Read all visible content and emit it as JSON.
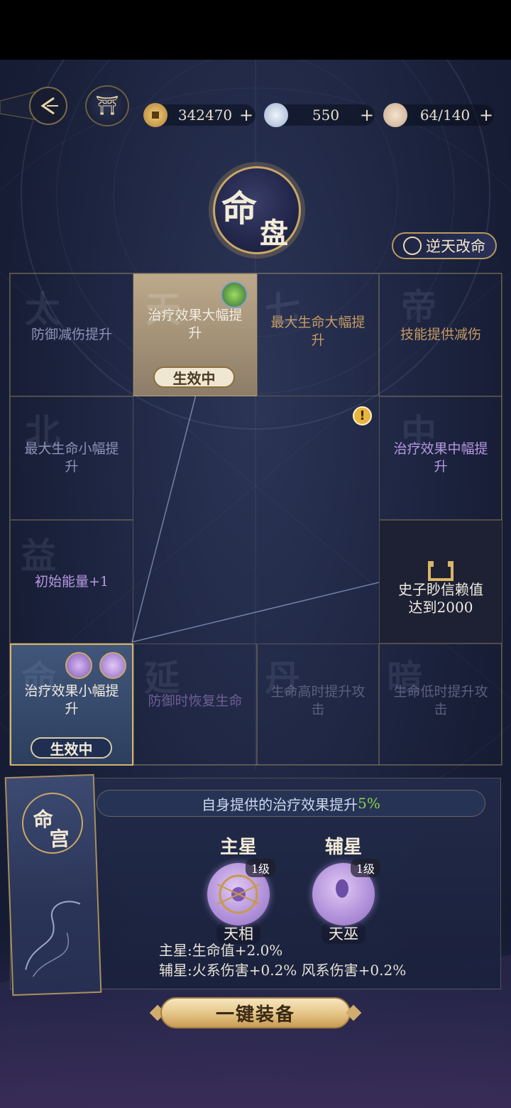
{
  "header": {
    "home_icon": "pavilion-icon",
    "back_icon": "back-arrow-icon"
  },
  "resources": [
    {
      "icon": "copper-coin-icon",
      "value": "342470",
      "plus": "+"
    },
    {
      "icon": "cloud-jade-icon",
      "value": "550",
      "plus": "+"
    },
    {
      "icon": "food-bowl-icon",
      "value": "64/140",
      "plus": "+"
    }
  ],
  "title": {
    "char1": "命",
    "char2": "盘"
  },
  "reverse_fate_button": {
    "label": "逆天改命"
  },
  "grid": {
    "row1": [
      {
        "label": "防御减伤提升",
        "bg": "太"
      },
      {
        "label": "治疗效果大幅提升",
        "bg": "天",
        "badge": "生效中"
      },
      {
        "label": "最大生命大幅提升",
        "bg": "七"
      },
      {
        "label": "技能提供减伤",
        "bg": "帝"
      }
    ],
    "left_col": [
      {
        "label": "最大生命小幅提升",
        "bg": "北"
      },
      {
        "label": "初始能量+1",
        "bg": "益"
      }
    ],
    "right_col": [
      {
        "label": "治疗效果中幅提升",
        "bg": "中"
      },
      {
        "label": "史子眇信赖值达到2000"
      }
    ],
    "row4": [
      {
        "label": "治疗效果小幅提升",
        "bg": "命",
        "badge": "生效中"
      },
      {
        "label": "防御时恢复生命",
        "bg": "延"
      },
      {
        "label": "生命高时提升攻击",
        "bg": "丹"
      },
      {
        "label": "生命低时提升攻击",
        "bg": "暗"
      }
    ],
    "alert_mark": "!"
  },
  "palace": {
    "title1": "命",
    "title2": "宫",
    "description": "自身提供的治疗效果提升",
    "description_pct": "5%",
    "main_star": {
      "heading": "主星",
      "level": "1级",
      "name": "天相"
    },
    "aux_star": {
      "heading": "辅星",
      "level": "1级",
      "name": "天巫"
    },
    "stat_main": "主星:生命值+2.0%",
    "stat_aux": "辅星:火系伤害+0.2% 风系伤害+0.2%"
  },
  "equip_button": {
    "label": "一键装备"
  },
  "colors": {
    "gold": "#c9a865",
    "active_green": "#8fd34b"
  }
}
